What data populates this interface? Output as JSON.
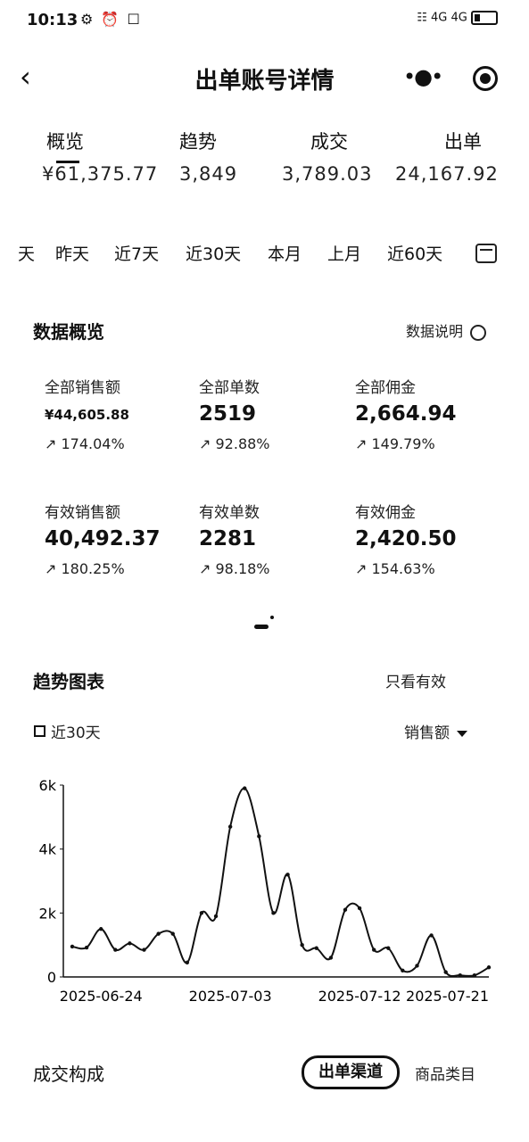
{
  "status_bar": {
    "time": "10:13",
    "left_icons": "⚙ ⏰ ☐",
    "right_icons": "☷ 4G 4G"
  },
  "header": {
    "title": "出单账号详情",
    "back_icon": "back-chevron-icon",
    "more_icon": "more-dots-icon",
    "target_icon": "target-icon"
  },
  "top_tabs": [
    {
      "label": "概览",
      "cut_value": "¥61,375.77"
    },
    {
      "label": "趋势",
      "cut_value": "3,849"
    },
    {
      "label": "成交",
      "cut_value": "3,789.03"
    },
    {
      "label": "出单",
      "cut_value": "24,167.92"
    }
  ],
  "date_filter": {
    "items": [
      "天",
      "昨天",
      "近7天",
      "近30天",
      "本月",
      "上月",
      "近60天"
    ],
    "selected": "近30天",
    "calendar_icon": "calendar-icon"
  },
  "overview": {
    "title": "数据概览",
    "explain_label": "数据说明",
    "metrics": [
      {
        "label": "全部销售额",
        "value": "¥44,605.88",
        "change": "174.04%"
      },
      {
        "label": "全部单数",
        "value": "2519",
        "change": "92.88%"
      },
      {
        "label": "全部佣金",
        "value": "2,664.94",
        "change": "149.79%"
      },
      {
        "label": "有效销售额",
        "value": "40,492.37",
        "change": "180.25%"
      },
      {
        "label": "有效单数",
        "value": "2281",
        "change": "98.18%"
      },
      {
        "label": "有效佣金",
        "value": "2,420.50",
        "change": "154.63%"
      }
    ],
    "trend_icon": "trend-up-icon"
  },
  "trend": {
    "title": "趋势图表",
    "only_valid_label": "只看有效",
    "legend_label": "近30天",
    "metric_select": "销售额"
  },
  "chart_data": {
    "type": "line",
    "series": [
      {
        "name": "近30天",
        "values": [
          950,
          920,
          1500,
          850,
          1050,
          850,
          1350,
          1350,
          450,
          2000,
          1900,
          4700,
          5900,
          4400,
          2000,
          3200,
          1000,
          900,
          600,
          2100,
          2150,
          850,
          900,
          200,
          350,
          1300,
          150,
          50,
          50,
          300
        ]
      }
    ],
    "x": [
      "2025-06-22",
      "2025-06-23",
      "2025-06-24",
      "2025-06-25",
      "2025-06-26",
      "2025-06-27",
      "2025-06-28",
      "2025-06-29",
      "2025-06-30",
      "2025-07-01",
      "2025-07-02",
      "2025-07-03",
      "2025-07-04",
      "2025-07-05",
      "2025-07-06",
      "2025-07-07",
      "2025-07-08",
      "2025-07-09",
      "2025-07-10",
      "2025-07-11",
      "2025-07-12",
      "2025-07-13",
      "2025-07-14",
      "2025-07-15",
      "2025-07-16",
      "2025-07-17",
      "2025-07-18",
      "2025-07-19",
      "2025-07-20",
      "2025-07-21"
    ],
    "x_tick_labels": [
      "2025-06-24",
      "2025-07-03",
      "2025-07-12",
      "2025-07-21"
    ],
    "y_tick_labels": [
      "0",
      "2k",
      "4k",
      "6k"
    ],
    "ylim": [
      0,
      6000
    ],
    "grid": false
  },
  "composition": {
    "title": "成交构成",
    "tab_active": "出单渠道",
    "tab_other": "商品类目"
  }
}
